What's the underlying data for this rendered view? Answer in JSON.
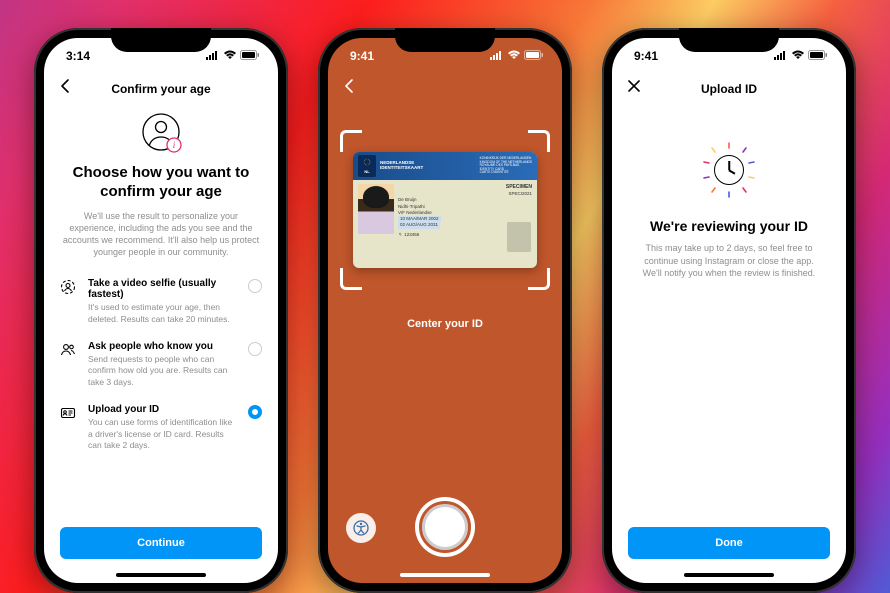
{
  "phone1": {
    "time": "3:14",
    "nav_title": "Confirm your age",
    "heading": "Choose how you want to confirm your age",
    "subtext": "We'll use the result to personalize your experience, including the ads you see and the accounts we recommend. It'll also help us protect younger people in our community.",
    "options": [
      {
        "title": "Take a video selfie (usually fastest)",
        "desc": "It's used to estimate your age, then deleted. Results can take 20 minutes.",
        "selected": false
      },
      {
        "title": "Ask people who know you",
        "desc": "Send requests to people who can confirm how old you are. Results can take 3 days.",
        "selected": false
      },
      {
        "title": "Upload your ID",
        "desc": "You can use forms of identification like a driver's license or ID card. Results can take 2 days.",
        "selected": true
      }
    ],
    "cta": "Continue"
  },
  "phone2": {
    "time": "9:41",
    "instruction": "Center your ID",
    "id_card": {
      "country_label": "NEDERLANDSE",
      "doc_type": "IDENTITEITSKAART",
      "kingdom_en": "KONINKRIJK DER NEDERLANDEN",
      "kingdom_sub1": "KINGDOM OF THE NETHERLANDS",
      "kingdom_sub2": "ROYAUME DES PAYS-BAS",
      "card_type": "IDENTITY CARD",
      "card_type2": "CARTE D'IDENTITÉ",
      "doc_no": "SPECI2021",
      "surname": "De Bruijn",
      "given": "Nidhi-Tripathi",
      "sex_nat": "V/F    Nederlandse",
      "dob": "10 MAA/MAR 2002",
      "expiry": "02 AUG/AUG 2031",
      "number": "123456",
      "specimen": "SPECIMEN"
    }
  },
  "phone3": {
    "time": "9:41",
    "nav_title": "Upload ID",
    "heading": "We're reviewing your ID",
    "subtext": "This may take up to 2 days, so feel free to continue using Instagram or close the app. We'll notify you when the review is finished.",
    "cta": "Done"
  }
}
